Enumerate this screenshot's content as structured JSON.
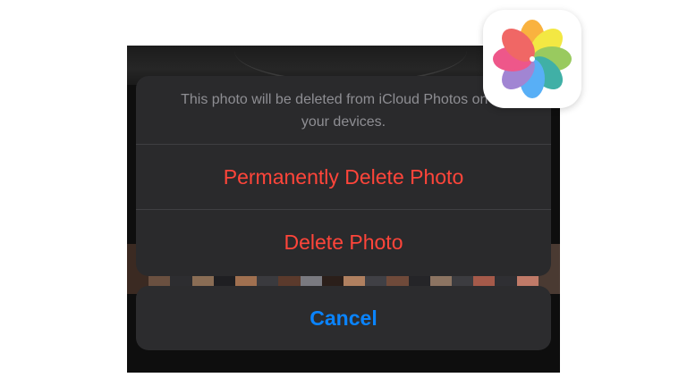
{
  "dialog": {
    "message": "This photo will be deleted from iCloud Photos on all your devices.",
    "actions": [
      {
        "label": "Permanently Delete Photo",
        "style": "destructive"
      },
      {
        "label": "Delete Photo",
        "style": "destructive"
      }
    ],
    "cancel_label": "Cancel"
  },
  "colors": {
    "destructive": "#ff453a",
    "cancel": "#0a84ff",
    "sheet_bg": "#2a2a2c",
    "message_text": "#8e8e93"
  },
  "app_icon": {
    "name": "photos-app-icon"
  },
  "thumbnails": {
    "colors": [
      "#3b2a22",
      "#6a5040",
      "#2d2d30",
      "#8a6d55",
      "#1f1f22",
      "#a07050",
      "#3a3a3e",
      "#5b3a2c",
      "#7a7a80",
      "#2b1f1a",
      "#b08060",
      "#404045",
      "#6f4a3a",
      "#252528",
      "#8c7462",
      "#3c3c40",
      "#a55a4a",
      "#2f2f33",
      "#c07a68",
      "#4a3a32"
    ]
  }
}
